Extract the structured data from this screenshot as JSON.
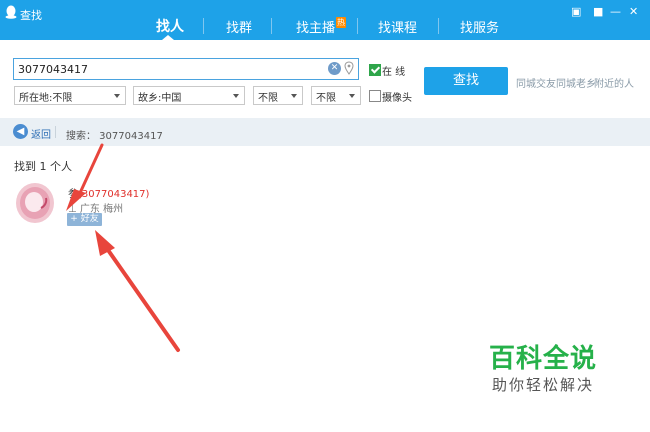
{
  "window": {
    "title": "查找",
    "controls": [
      "▣",
      "■",
      "—",
      "✕"
    ]
  },
  "tabs": [
    {
      "label": "找人",
      "active": true
    },
    {
      "label": "找群"
    },
    {
      "label": "找主播",
      "badge": "热"
    },
    {
      "label": "找课程"
    },
    {
      "label": "找服务"
    }
  ],
  "search": {
    "value": "3077043417",
    "clear_glyph": "✕",
    "online_label": "在 线",
    "camera_label": "摄像头",
    "find_label": "查找",
    "location_value": "所在地:不限",
    "hometown_value": "故乡:中国",
    "gender_value": "不限",
    "age_value": "不限",
    "quick_links": [
      "同城交友",
      "同城老乡",
      "附近的人"
    ]
  },
  "nav": {
    "back_label": "返回",
    "search_echo": "搜索： 3077043417"
  },
  "results": {
    "count_text": "找到 1 个人",
    "items": [
      {
        "name": "参",
        "qq": "(3077043417)",
        "location": "广东 梅州",
        "add_label": "+ 好友"
      }
    ]
  },
  "watermark": {
    "main": "百科全说",
    "sub": "助你轻松解决"
  },
  "colors": {
    "accent": "#1ea2e8",
    "qq_number": "#e0302b",
    "watermark_green": "#26b14a",
    "annotation_arrow": "#e8453c"
  }
}
